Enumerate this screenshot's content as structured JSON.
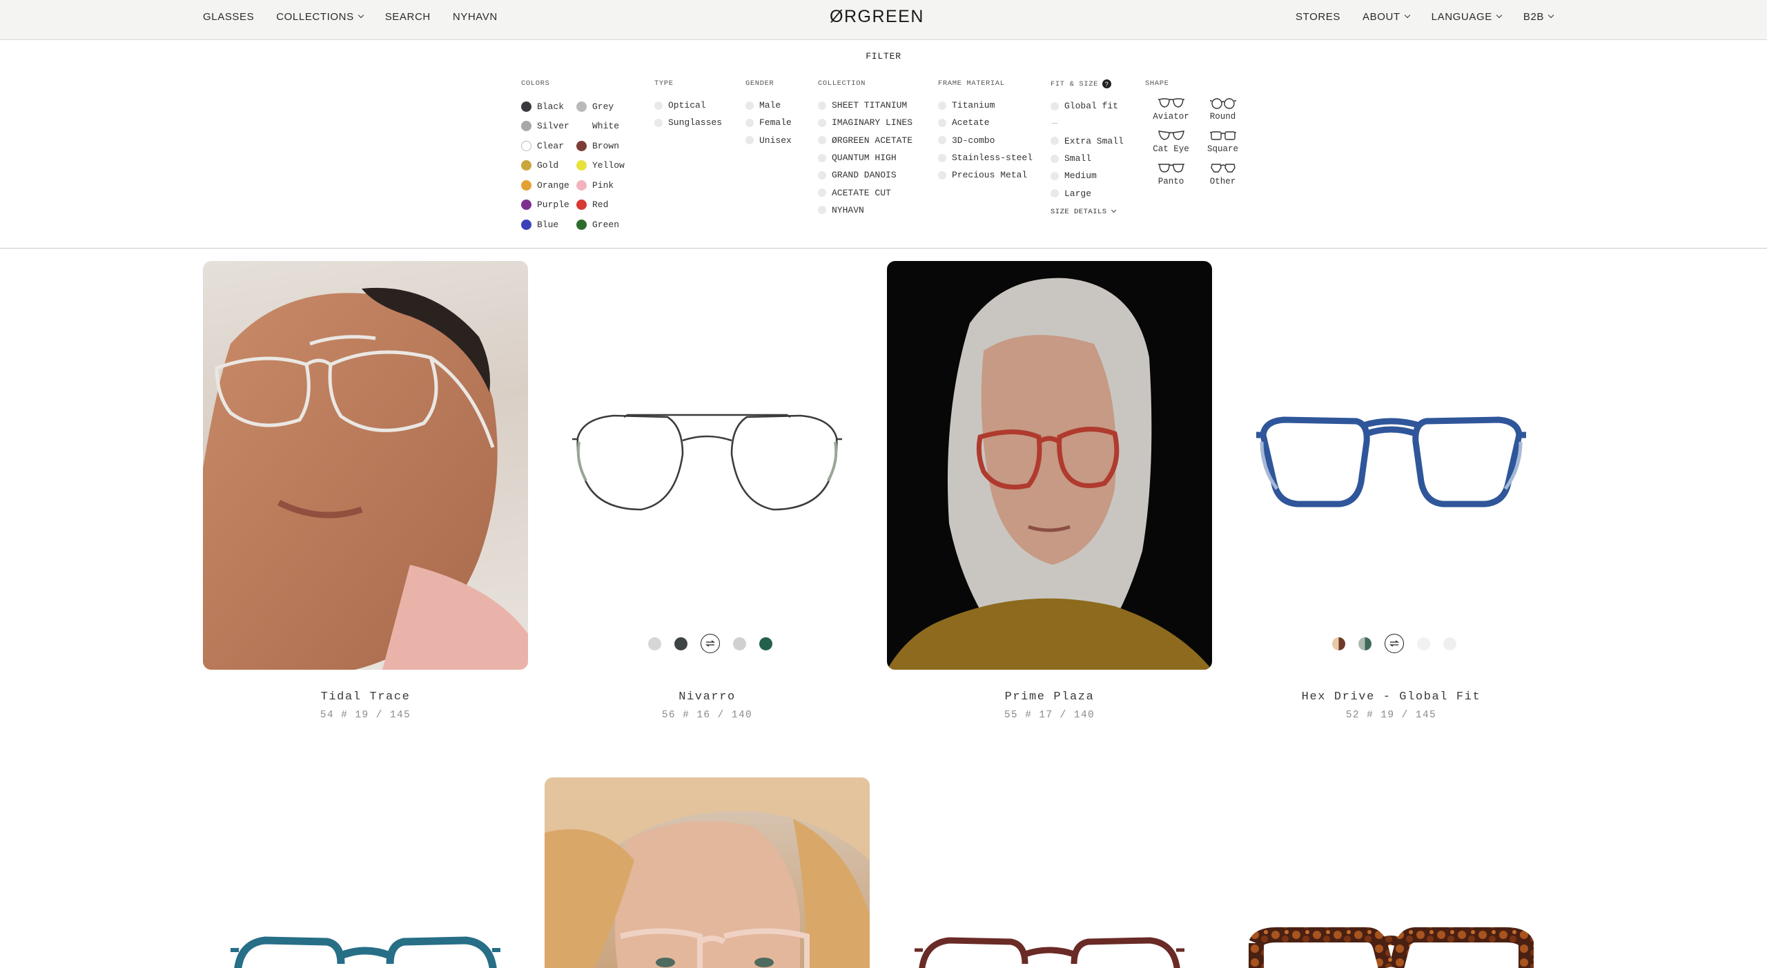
{
  "header": {
    "logo": "ØRGREEN",
    "nav_left": [
      {
        "label": "GLASSES",
        "dropdown": false
      },
      {
        "label": "COLLECTIONS",
        "dropdown": true
      },
      {
        "label": "SEARCH",
        "dropdown": false
      },
      {
        "label": "NYHAVN",
        "dropdown": false
      }
    ],
    "nav_right": [
      {
        "label": "STORES",
        "dropdown": false
      },
      {
        "label": "ABOUT",
        "dropdown": true
      },
      {
        "label": "LANGUAGE",
        "dropdown": true
      },
      {
        "label": "B2B",
        "dropdown": true
      }
    ]
  },
  "filter": {
    "title": "FILTER",
    "colors": {
      "heading": "COLORS",
      "items": [
        {
          "label": "Black",
          "color": "#3a3a3e"
        },
        {
          "label": "Grey",
          "color": "#b9b9b9"
        },
        {
          "label": "Silver",
          "color": "#a8a8a8"
        },
        {
          "label": "White",
          "color": "#ffffff"
        },
        {
          "label": "Clear",
          "color": "#ffffff"
        },
        {
          "label": "Brown",
          "color": "#7b3d36"
        },
        {
          "label": "Gold",
          "color": "#c9a53c"
        },
        {
          "label": "Yellow",
          "color": "#e6e23a"
        },
        {
          "label": "Orange",
          "color": "#e4a133"
        },
        {
          "label": "Pink",
          "color": "#f1b4be"
        },
        {
          "label": "Purple",
          "color": "#7d2f8f"
        },
        {
          "label": "Red",
          "color": "#d63a33"
        },
        {
          "label": "Blue",
          "color": "#3c3fb8"
        },
        {
          "label": "Green",
          "color": "#2f6b2c"
        }
      ]
    },
    "type": {
      "heading": "TYPE",
      "items": [
        "Optical",
        "Sunglasses"
      ]
    },
    "gender": {
      "heading": "GENDER",
      "items": [
        "Male",
        "Female",
        "Unisex"
      ]
    },
    "collection": {
      "heading": "COLLECTION",
      "items": [
        "SHEET TITANIUM",
        "IMAGINARY LINES",
        "ØRGREEN ACETATE",
        "QUANTUM HIGH",
        "GRAND DANOIS",
        "ACETATE CUT",
        "NYHAVN"
      ]
    },
    "material": {
      "heading": "FRAME MATERIAL",
      "items": [
        "Titanium",
        "Acetate",
        "3D-combo",
        "Stainless-steel",
        "Precious Metal"
      ]
    },
    "fit": {
      "heading": "FIT & SIZE",
      "help": "?",
      "primary": "Global fit",
      "divider": "—",
      "items": [
        "Extra Small",
        "Small",
        "Medium",
        "Large"
      ],
      "details": "SIZE DETAILS"
    },
    "shape": {
      "heading": "SHAPE",
      "items": [
        "Aviator",
        "Round",
        "Cat Eye",
        "Square",
        "Panto",
        "Other"
      ]
    }
  },
  "products": [
    {
      "name": "Tidal Trace",
      "measurements": "54 # 19 / 145"
    },
    {
      "name": "Nivarro",
      "measurements": "56 # 16 / 140",
      "swatches": [
        "#d6d6d6",
        "#3e4446",
        "selected",
        "#d0d0d0",
        "#23614b"
      ]
    },
    {
      "name": "Prime Plaza",
      "measurements": "55 # 17 / 140"
    },
    {
      "name": "Hex Drive - Global Fit",
      "measurements": "52 # 19 / 145",
      "swatches": [
        "#c9996e",
        "#6b8878",
        "selected",
        "#f1f1f1",
        "#efefef"
      ]
    }
  ]
}
